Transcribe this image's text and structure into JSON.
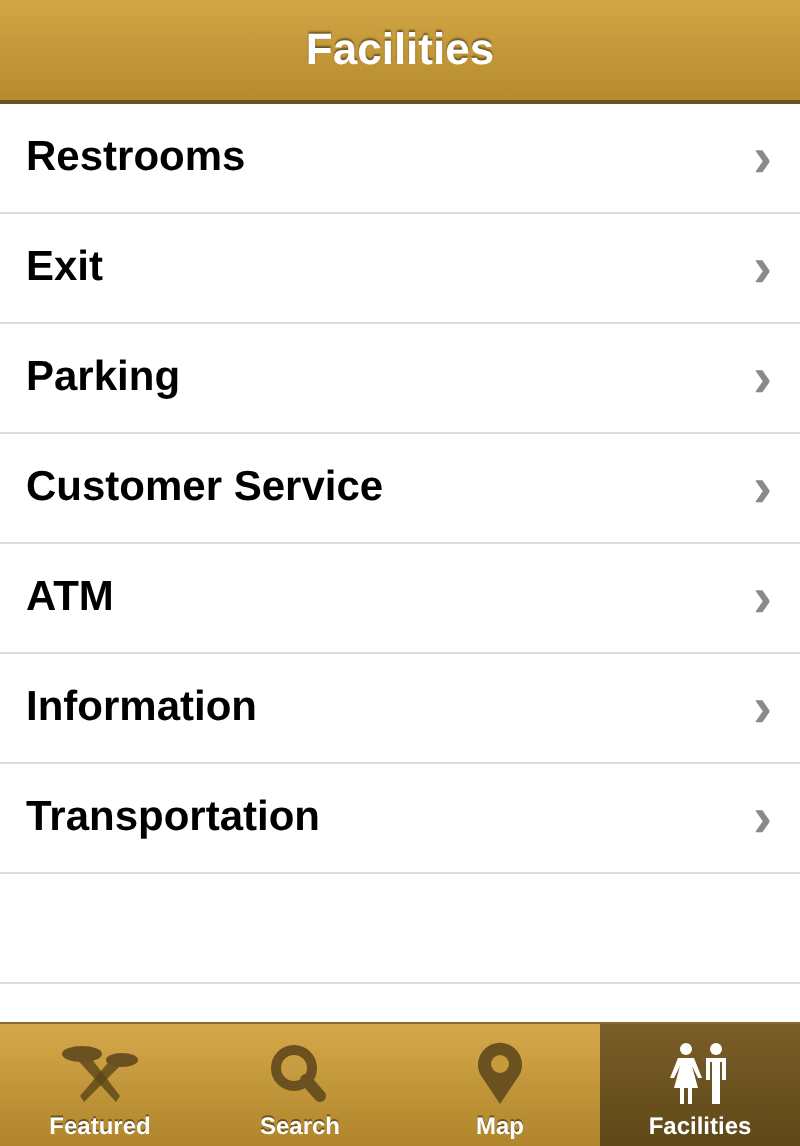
{
  "nav_bar": {
    "title": "Facilities"
  },
  "items": [
    {
      "label": "Restrooms",
      "chevron": "›"
    },
    {
      "label": "Exit",
      "chevron": "›"
    },
    {
      "label": "Parking",
      "chevron": "›"
    },
    {
      "label": "Customer Service",
      "chevron": "›"
    },
    {
      "label": "ATM",
      "chevron": "›"
    },
    {
      "label": "Information",
      "chevron": "›"
    },
    {
      "label": "Transportation",
      "chevron": "›"
    }
  ],
  "tab_bar": [
    {
      "label": "Featured",
      "kind": "featured",
      "selected": false
    },
    {
      "label": "Search",
      "kind": "search",
      "selected": false
    },
    {
      "label": "Map",
      "kind": "map",
      "selected": false
    },
    {
      "label": "Facilities",
      "kind": "facilities",
      "selected": true
    }
  ]
}
